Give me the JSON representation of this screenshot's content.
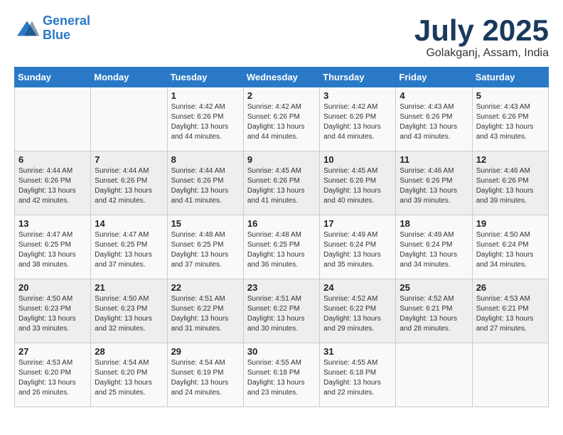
{
  "header": {
    "logo_line1": "General",
    "logo_line2": "Blue",
    "month": "July 2025",
    "location": "Golakganj, Assam, India"
  },
  "weekdays": [
    "Sunday",
    "Monday",
    "Tuesday",
    "Wednesday",
    "Thursday",
    "Friday",
    "Saturday"
  ],
  "weeks": [
    [
      {
        "day": "",
        "content": ""
      },
      {
        "day": "",
        "content": ""
      },
      {
        "day": "1",
        "content": "Sunrise: 4:42 AM\nSunset: 6:26 PM\nDaylight: 13 hours and 44 minutes."
      },
      {
        "day": "2",
        "content": "Sunrise: 4:42 AM\nSunset: 6:26 PM\nDaylight: 13 hours and 44 minutes."
      },
      {
        "day": "3",
        "content": "Sunrise: 4:42 AM\nSunset: 6:26 PM\nDaylight: 13 hours and 44 minutes."
      },
      {
        "day": "4",
        "content": "Sunrise: 4:43 AM\nSunset: 6:26 PM\nDaylight: 13 hours and 43 minutes."
      },
      {
        "day": "5",
        "content": "Sunrise: 4:43 AM\nSunset: 6:26 PM\nDaylight: 13 hours and 43 minutes."
      }
    ],
    [
      {
        "day": "6",
        "content": "Sunrise: 4:44 AM\nSunset: 6:26 PM\nDaylight: 13 hours and 42 minutes."
      },
      {
        "day": "7",
        "content": "Sunrise: 4:44 AM\nSunset: 6:26 PM\nDaylight: 13 hours and 42 minutes."
      },
      {
        "day": "8",
        "content": "Sunrise: 4:44 AM\nSunset: 6:26 PM\nDaylight: 13 hours and 41 minutes."
      },
      {
        "day": "9",
        "content": "Sunrise: 4:45 AM\nSunset: 6:26 PM\nDaylight: 13 hours and 41 minutes."
      },
      {
        "day": "10",
        "content": "Sunrise: 4:45 AM\nSunset: 6:26 PM\nDaylight: 13 hours and 40 minutes."
      },
      {
        "day": "11",
        "content": "Sunrise: 4:46 AM\nSunset: 6:26 PM\nDaylight: 13 hours and 39 minutes."
      },
      {
        "day": "12",
        "content": "Sunrise: 4:46 AM\nSunset: 6:26 PM\nDaylight: 13 hours and 39 minutes."
      }
    ],
    [
      {
        "day": "13",
        "content": "Sunrise: 4:47 AM\nSunset: 6:25 PM\nDaylight: 13 hours and 38 minutes."
      },
      {
        "day": "14",
        "content": "Sunrise: 4:47 AM\nSunset: 6:25 PM\nDaylight: 13 hours and 37 minutes."
      },
      {
        "day": "15",
        "content": "Sunrise: 4:48 AM\nSunset: 6:25 PM\nDaylight: 13 hours and 37 minutes."
      },
      {
        "day": "16",
        "content": "Sunrise: 4:48 AM\nSunset: 6:25 PM\nDaylight: 13 hours and 36 minutes."
      },
      {
        "day": "17",
        "content": "Sunrise: 4:49 AM\nSunset: 6:24 PM\nDaylight: 13 hours and 35 minutes."
      },
      {
        "day": "18",
        "content": "Sunrise: 4:49 AM\nSunset: 6:24 PM\nDaylight: 13 hours and 34 minutes."
      },
      {
        "day": "19",
        "content": "Sunrise: 4:50 AM\nSunset: 6:24 PM\nDaylight: 13 hours and 34 minutes."
      }
    ],
    [
      {
        "day": "20",
        "content": "Sunrise: 4:50 AM\nSunset: 6:23 PM\nDaylight: 13 hours and 33 minutes."
      },
      {
        "day": "21",
        "content": "Sunrise: 4:50 AM\nSunset: 6:23 PM\nDaylight: 13 hours and 32 minutes."
      },
      {
        "day": "22",
        "content": "Sunrise: 4:51 AM\nSunset: 6:22 PM\nDaylight: 13 hours and 31 minutes."
      },
      {
        "day": "23",
        "content": "Sunrise: 4:51 AM\nSunset: 6:22 PM\nDaylight: 13 hours and 30 minutes."
      },
      {
        "day": "24",
        "content": "Sunrise: 4:52 AM\nSunset: 6:22 PM\nDaylight: 13 hours and 29 minutes."
      },
      {
        "day": "25",
        "content": "Sunrise: 4:52 AM\nSunset: 6:21 PM\nDaylight: 13 hours and 28 minutes."
      },
      {
        "day": "26",
        "content": "Sunrise: 4:53 AM\nSunset: 6:21 PM\nDaylight: 13 hours and 27 minutes."
      }
    ],
    [
      {
        "day": "27",
        "content": "Sunrise: 4:53 AM\nSunset: 6:20 PM\nDaylight: 13 hours and 26 minutes."
      },
      {
        "day": "28",
        "content": "Sunrise: 4:54 AM\nSunset: 6:20 PM\nDaylight: 13 hours and 25 minutes."
      },
      {
        "day": "29",
        "content": "Sunrise: 4:54 AM\nSunset: 6:19 PM\nDaylight: 13 hours and 24 minutes."
      },
      {
        "day": "30",
        "content": "Sunrise: 4:55 AM\nSunset: 6:18 PM\nDaylight: 13 hours and 23 minutes."
      },
      {
        "day": "31",
        "content": "Sunrise: 4:55 AM\nSunset: 6:18 PM\nDaylight: 13 hours and 22 minutes."
      },
      {
        "day": "",
        "content": ""
      },
      {
        "day": "",
        "content": ""
      }
    ]
  ]
}
